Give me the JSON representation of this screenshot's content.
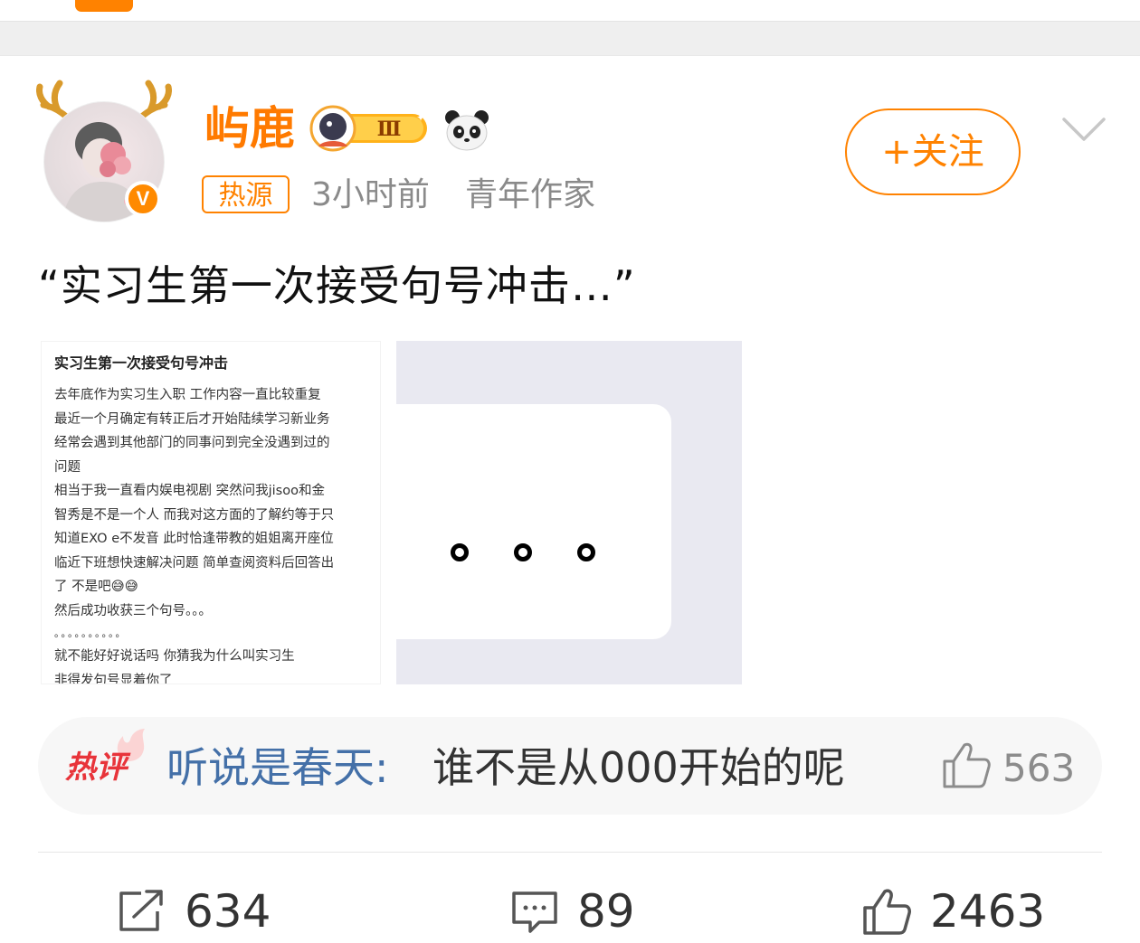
{
  "post": {
    "author": {
      "name": "屿鹿",
      "verified_badge": "V",
      "level_badge_text": "Ⅲ"
    },
    "hot_tag": "热源",
    "time": "3小时前",
    "author_title": "青年作家",
    "follow_label": "+关注",
    "text": "“实习生第一次接受句号冲击…”",
    "image_left": {
      "title": "实习生第一次接受句号冲击",
      "lines": [
        "去年底作为实习生入职 工作内容一直比较重复",
        "最近一个月确定有转正后才开始陆续学习新业务",
        "经常会遇到其他部门的同事问到完全没遇到过的",
        "问题",
        "相当于我一直看内娱电视剧 突然问我jisoo和金",
        "智秀是不是一个人 而我对这方面的了解约等于只",
        "知道EXO e不发音 此时恰逢带教的姐姐离开座位",
        "临近下班想快速解决问题 简单查阅资料后回答出",
        "了 不是吧😅😅",
        "然后成功收获三个句号。。。",
        "。。。。。。。。。。",
        "就不能好好说话吗 你猜我为什么叫实习生",
        "非得发句号显着你了"
      ]
    },
    "hot_comment": {
      "label": "热评",
      "user": "听说是春天:",
      "text": "谁不是从000开始的呢",
      "likes": "563"
    },
    "actions": {
      "reposts": "634",
      "comments": "89",
      "likes": "2463"
    }
  },
  "colors": {
    "accent": "#ff8200",
    "link": "#4470a8",
    "hot_red": "#e8343a"
  }
}
